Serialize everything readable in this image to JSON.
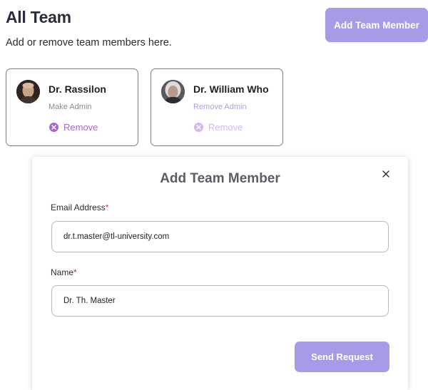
{
  "header": {
    "title": "All Team",
    "subtitle": "Add or remove team members here.",
    "add_button_label": "Add Team Member"
  },
  "members": [
    {
      "name": "Dr. Rassilon",
      "role_action": "Make Admin",
      "remove_label": "Remove",
      "avatar": "person-avatar"
    },
    {
      "name": "Dr. William Who",
      "role_action": "Remove Admin",
      "remove_label": "Remove",
      "avatar": "person-avatar"
    }
  ],
  "modal": {
    "title": "Add Team Member",
    "close_icon": "close-icon",
    "email": {
      "label": "Email Address",
      "required_mark": "*",
      "value": "dr.t.master@tl-university.com"
    },
    "name": {
      "label": "Name",
      "required_mark": "*",
      "value": "Dr. Th. Master"
    },
    "submit_label": "Send Request"
  },
  "colors": {
    "accent": "#a79ae7",
    "remove": "#a46acb",
    "required": "#c8323a"
  }
}
